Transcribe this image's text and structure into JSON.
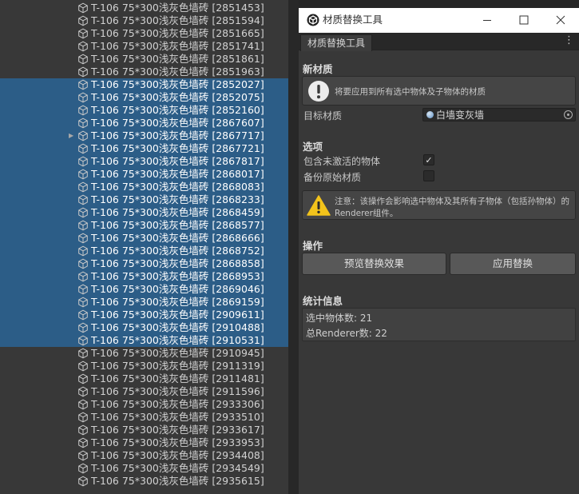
{
  "hierarchy": {
    "items": [
      {
        "label": "T-106 75*300浅灰色墙砖 [2851453]",
        "selected": false
      },
      {
        "label": "T-106 75*300浅灰色墙砖 [2851594]",
        "selected": false
      },
      {
        "label": "T-106 75*300浅灰色墙砖 [2851665]",
        "selected": false
      },
      {
        "label": "T-106 75*300浅灰色墙砖 [2851741]",
        "selected": false
      },
      {
        "label": "T-106 75*300浅灰色墙砖 [2851861]",
        "selected": false
      },
      {
        "label": "T-106 75*300浅灰色墙砖 [2851963]",
        "selected": false
      },
      {
        "label": "T-106 75*300浅灰色墙砖 [2852027]",
        "selected": true
      },
      {
        "label": "T-106 75*300浅灰色墙砖 [2852075]",
        "selected": true
      },
      {
        "label": "T-106 75*300浅灰色墙砖 [2852160]",
        "selected": true
      },
      {
        "label": "T-106 75*300浅灰色墙砖 [2867607]",
        "selected": true
      },
      {
        "label": "T-106 75*300浅灰色墙砖 [2867717]",
        "selected": true,
        "expandable": true
      },
      {
        "label": "T-106 75*300浅灰色墙砖 [2867721]",
        "selected": true
      },
      {
        "label": "T-106 75*300浅灰色墙砖 [2867817]",
        "selected": true
      },
      {
        "label": "T-106 75*300浅灰色墙砖 [2868017]",
        "selected": true
      },
      {
        "label": "T-106 75*300浅灰色墙砖 [2868083]",
        "selected": true
      },
      {
        "label": "T-106 75*300浅灰色墙砖 [2868233]",
        "selected": true
      },
      {
        "label": "T-106 75*300浅灰色墙砖 [2868459]",
        "selected": true
      },
      {
        "label": "T-106 75*300浅灰色墙砖 [2868577]",
        "selected": true
      },
      {
        "label": "T-106 75*300浅灰色墙砖 [2868666]",
        "selected": true
      },
      {
        "label": "T-106 75*300浅灰色墙砖 [2868752]",
        "selected": true
      },
      {
        "label": "T-106 75*300浅灰色墙砖 [2868858]",
        "selected": true
      },
      {
        "label": "T-106 75*300浅灰色墙砖 [2868953]",
        "selected": true
      },
      {
        "label": "T-106 75*300浅灰色墙砖 [2869046]",
        "selected": true
      },
      {
        "label": "T-106 75*300浅灰色墙砖 [2869159]",
        "selected": true
      },
      {
        "label": "T-106 75*300浅灰色墙砖 [2909611]",
        "selected": true
      },
      {
        "label": "T-106 75*300浅灰色墙砖 [2910488]",
        "selected": true
      },
      {
        "label": "T-106 75*300浅灰色墙砖 [2910531]",
        "selected": true
      },
      {
        "label": "T-106 75*300浅灰色墙砖 [2910945]",
        "selected": false
      },
      {
        "label": "T-106 75*300浅灰色墙砖 [2911319]",
        "selected": false
      },
      {
        "label": "T-106 75*300浅灰色墙砖 [2911481]",
        "selected": false
      },
      {
        "label": "T-106 75*300浅灰色墙砖 [2911596]",
        "selected": false
      },
      {
        "label": "T-106 75*300浅灰色墙砖 [2933306]",
        "selected": false
      },
      {
        "label": "T-106 75*300浅灰色墙砖 [2933510]",
        "selected": false
      },
      {
        "label": "T-106 75*300浅灰色墙砖 [2933617]",
        "selected": false
      },
      {
        "label": "T-106 75*300浅灰色墙砖 [2933953]",
        "selected": false
      },
      {
        "label": "T-106 75*300浅灰色墙砖 [2934408]",
        "selected": false
      },
      {
        "label": "T-106 75*300浅灰色墙砖 [2934549]",
        "selected": false
      },
      {
        "label": "T-106 75*300浅灰色墙砖 [2935615]",
        "selected": false
      }
    ]
  },
  "window": {
    "title": "材质替换工具",
    "tab": "材质替换工具",
    "icons": {
      "logo": "unity-logo-icon",
      "minimize": "minimize-icon",
      "maximize": "maximize-icon",
      "close": "close-icon",
      "menu": "kebab-menu-icon"
    }
  },
  "new_material": {
    "title": "新材质",
    "info": "将要应用到所有选中物体及子物体的材质",
    "target_label": "目标材质",
    "target_value": "白墙变灰墙"
  },
  "options": {
    "title": "选项",
    "include_inactive_label": "包含未激活的物体",
    "include_inactive_checked": true,
    "backup_label": "备份原始材质",
    "backup_checked": false,
    "warning_line1": "注意：该操作会影响选中物体及其所有子物体（包括孙物体）的",
    "warning_line2": "Renderer组件。"
  },
  "actions": {
    "title": "操作",
    "preview_label": "预览替换效果",
    "apply_label": "应用替换"
  },
  "stats": {
    "title": "统计信息",
    "selected_objects": "选中物体数: 21",
    "renderer_count": "总Renderer数: 22"
  },
  "colors": {
    "selection": "#2c5d87",
    "panel": "#383838",
    "warning": "#f2c31b"
  }
}
